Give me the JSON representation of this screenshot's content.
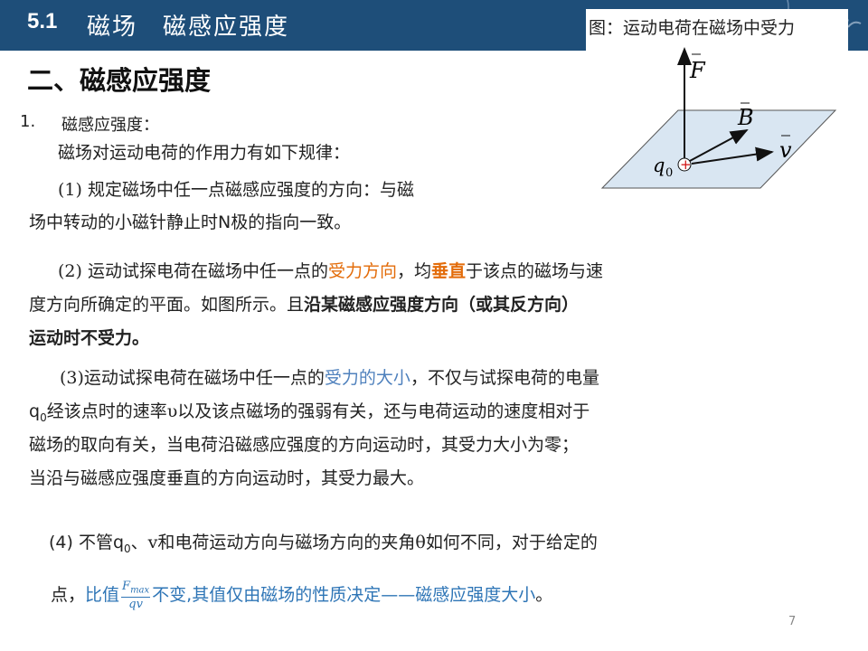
{
  "header": {
    "num": "5.1",
    "title": "磁场　磁感应强度"
  },
  "section_title": "二、磁感应强度",
  "figure": {
    "caption": "图：运动电荷在磁场中受力",
    "F": "F",
    "B": "B",
    "v": "v",
    "q": "q",
    "q_sub": "0"
  },
  "item1": {
    "num": "1.",
    "label": "磁感应强度："
  },
  "intro": "磁场对运动电荷的作用力有如下规律：",
  "p1": {
    "a": "(1) 规定磁场中",
    "b": "任一点磁感应强度的方向：与磁",
    "c": "场中转动的小磁针静止时N极的指向一致。"
  },
  "p2": {
    "a": "(2) 运动试探电荷在磁场中任一点的",
    "b": "受力方向",
    "c": "，均",
    "d": "垂直",
    "e": "于该点的磁场与速",
    "f": "度方向所确定的平面。如图所示。且",
    "g": "沿某磁感应强度方向（或其反方向）",
    "h": "运动时不受力。"
  },
  "p3": {
    "a": "(3)运动试探电荷在磁场中任一点的",
    "b": "受力的大小",
    "c": "，不仅与试探电荷的电量",
    "d": "q",
    "d_sub": "0",
    "e": "经该点时的速率υ以及该点磁场的强弱有关，还与电荷运动的速度相对于",
    "f": "磁场的取向有关，",
    "g": "当电荷沿磁感应强度的方向运动时，其受力大小为零；",
    "h": "当沿与磁感应强度垂直的方向运动时，其受力最大。"
  },
  "p4": {
    "a": "(4) 不管q",
    "a_sub": "0",
    "b": "、v和电荷运动方向与磁场方向的夹角θ如何不同，对于给定的",
    "c": "点，",
    "d": "比值",
    "frac_num": "F",
    "frac_num_sub": "max",
    "frac_den": "qv",
    "e": "不变,其值仅由磁场的性质决定——磁感应强度大小",
    "f": "。"
  },
  "page_number": "7",
  "colors": {
    "header_bg": "#1e4e79",
    "orange": "#e36c0a",
    "blue": "#4f81bd",
    "blue2": "#2e75b6"
  }
}
